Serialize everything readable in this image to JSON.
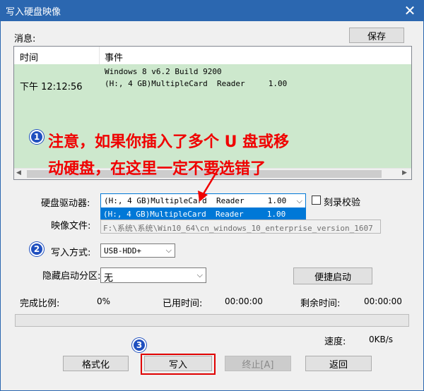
{
  "window": {
    "title": "写入硬盘映像",
    "close_glyph": "✕"
  },
  "messages": {
    "label": "消息:",
    "save_label": "保存"
  },
  "log": {
    "columns": [
      "时间",
      "事件"
    ],
    "rows": [
      {
        "time": "",
        "event": "Windows 8 v6.2 Build 9200"
      },
      {
        "time": "下午 12:12:56",
        "event": "(H:, 4 GB)MultipleCard  Reader     1.00"
      }
    ],
    "scroll_left": "◀",
    "scroll_right": "▶"
  },
  "annotations": {
    "step1": "1",
    "step2": "2",
    "step3": "3",
    "note_line1": "注意，如果你插入了多个 U 盘或移",
    "note_line2": "动硬盘，在这里一定不要选错了"
  },
  "form": {
    "drive_label": "硬盘驱动器:",
    "drive_value": "(H:, 4 GB)MultipleCard  Reader     1.00",
    "drive_option": "(H:, 4 GB)MultipleCard  Reader     1.00",
    "verify_label": "刻录校验",
    "verify_checked": false,
    "image_label": "映像文件:",
    "image_value": "F:\\系统\\系统\\Win10_64\\cn_windows_10_enterprise_version_1607",
    "write_mode_label": "写入方式:",
    "write_mode_value": "USB-HDD+",
    "hidden_label": "隐藏启动分区:",
    "hidden_value": "无",
    "quickboot_label": "便捷启动"
  },
  "status": {
    "completion_label": "完成比例:",
    "completion_value": "0%",
    "elapsed_label": "已用时间:",
    "elapsed_value": "00:00:00",
    "remaining_label": "剩余时间:",
    "remaining_value": "00:00:00",
    "progress": 0,
    "speed_label": "速度:",
    "speed_value": "0KB/s"
  },
  "buttons": {
    "format": "格式化",
    "write": "写入",
    "stop": "终止[A]",
    "back": "返回"
  },
  "colors": {
    "titlebar": "#2b67b0",
    "log_highlight": "#cde8cd",
    "annotation": "#f00000",
    "step_badge": "#1f4fbf"
  }
}
